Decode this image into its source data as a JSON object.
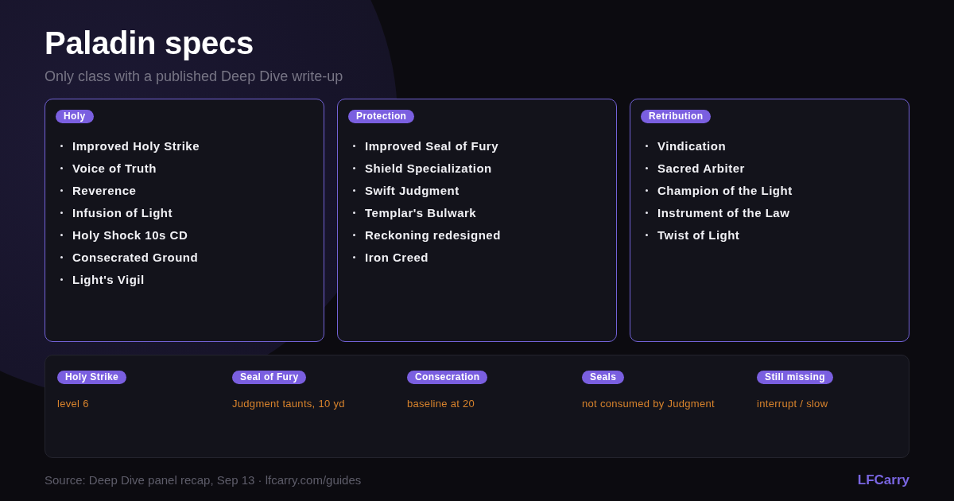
{
  "header": {
    "title": "Paladin specs",
    "subtitle": "Only class with a published Deep Dive write-up"
  },
  "specs": [
    {
      "name": "Holy",
      "talents": [
        "Improved Holy Strike",
        "Voice of Truth",
        "Reverence",
        "Infusion of Light",
        "Holy Shock 10s CD",
        "Consecrated Ground",
        "Light's Vigil"
      ]
    },
    {
      "name": "Protection",
      "talents": [
        "Improved Seal of Fury",
        "Shield Specialization",
        "Swift Judgment",
        "Templar's Bulwark",
        "Reckoning redesigned",
        "Iron Creed"
      ]
    },
    {
      "name": "Retribution",
      "talents": [
        "Vindication",
        "Sacred Arbiter",
        "Champion of the Light",
        "Instrument of the Law",
        "Twist of Light"
      ]
    }
  ],
  "notes": [
    {
      "label": "Holy Strike",
      "value": "level 6"
    },
    {
      "label": "Seal of Fury",
      "value": "Judgment taunts, 10 yd"
    },
    {
      "label": "Consecration",
      "value": "baseline at 20"
    },
    {
      "label": "Seals",
      "value": "not consumed by Judgment"
    },
    {
      "label": "Still missing",
      "value": "interrupt / slow"
    }
  ],
  "footer": {
    "source": "Source: Deep Dive panel recap, Sep 13 · lfcarry.com/guides",
    "brand": "LFCarry"
  }
}
